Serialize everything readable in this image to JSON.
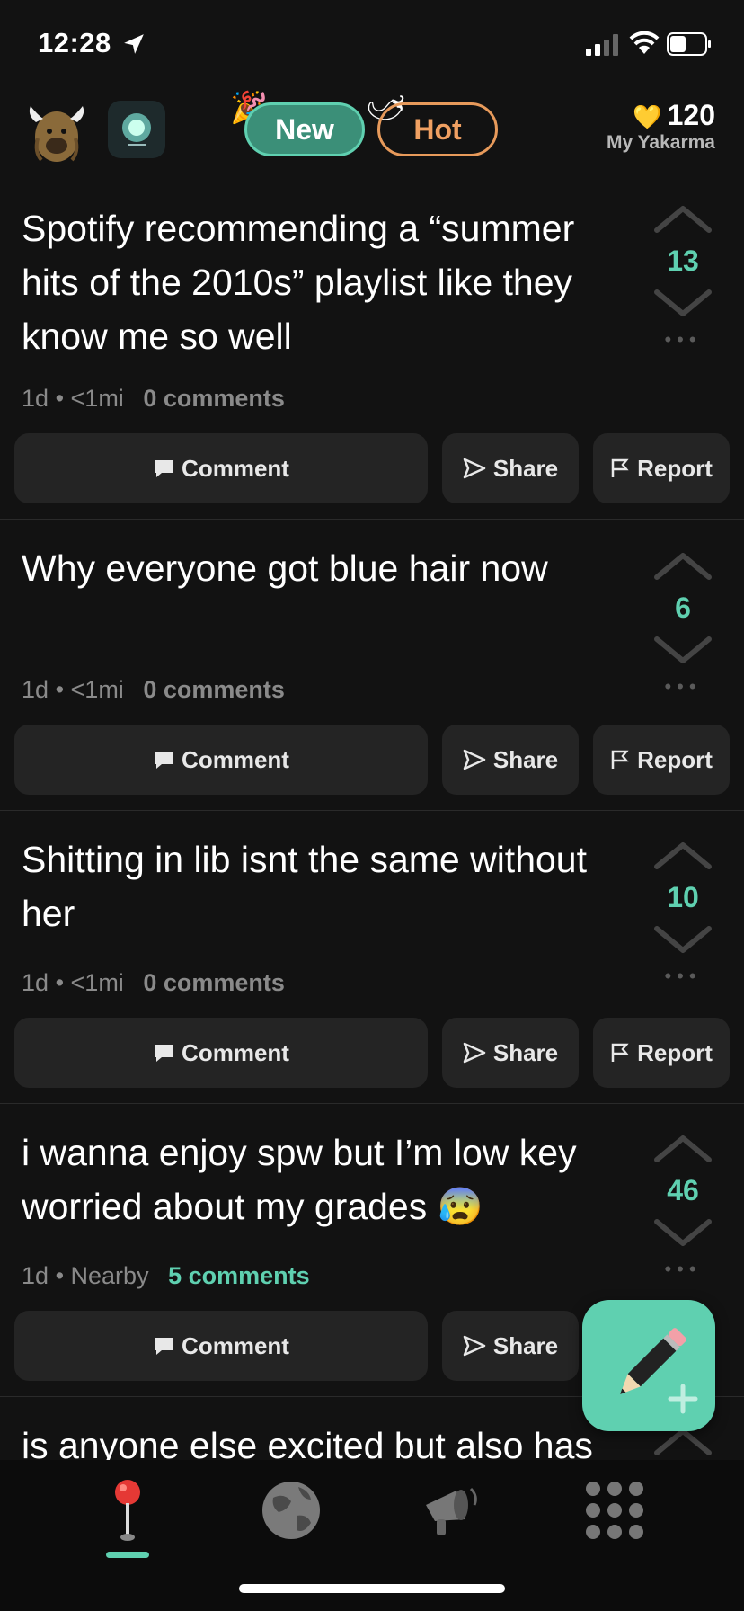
{
  "status_bar": {
    "time": "12:28"
  },
  "header": {
    "tabs": [
      {
        "label": "New"
      },
      {
        "label": "Hot"
      }
    ],
    "karma": {
      "value": "120",
      "label": "My Yakarma"
    }
  },
  "posts": [
    {
      "text": "Spotify recommending a “summer hits of the 2010s” playlist like they know me so well",
      "age": "1d",
      "distance": "<1mi",
      "comments": "0 comments",
      "score": "13"
    },
    {
      "text": "Why everyone got blue hair now",
      "age": "1d",
      "distance": "<1mi",
      "comments": "0 comments",
      "score": "6"
    },
    {
      "text": "Shitting in lib isnt the same without her",
      "age": "1d",
      "distance": "<1mi",
      "comments": "0 comments",
      "score": "10"
    },
    {
      "text": "i wanna enjoy spw but I’m low key worried about my grades 😰",
      "age": "1d",
      "distance": "Nearby",
      "comments": "5 comments",
      "score": "46"
    },
    {
      "text": "is anyone else excited but also has"
    }
  ],
  "actions": {
    "comment": "Comment",
    "share": "Share",
    "report": "Report"
  },
  "meta_separator": "•",
  "accent_color": "#5fd0b0"
}
